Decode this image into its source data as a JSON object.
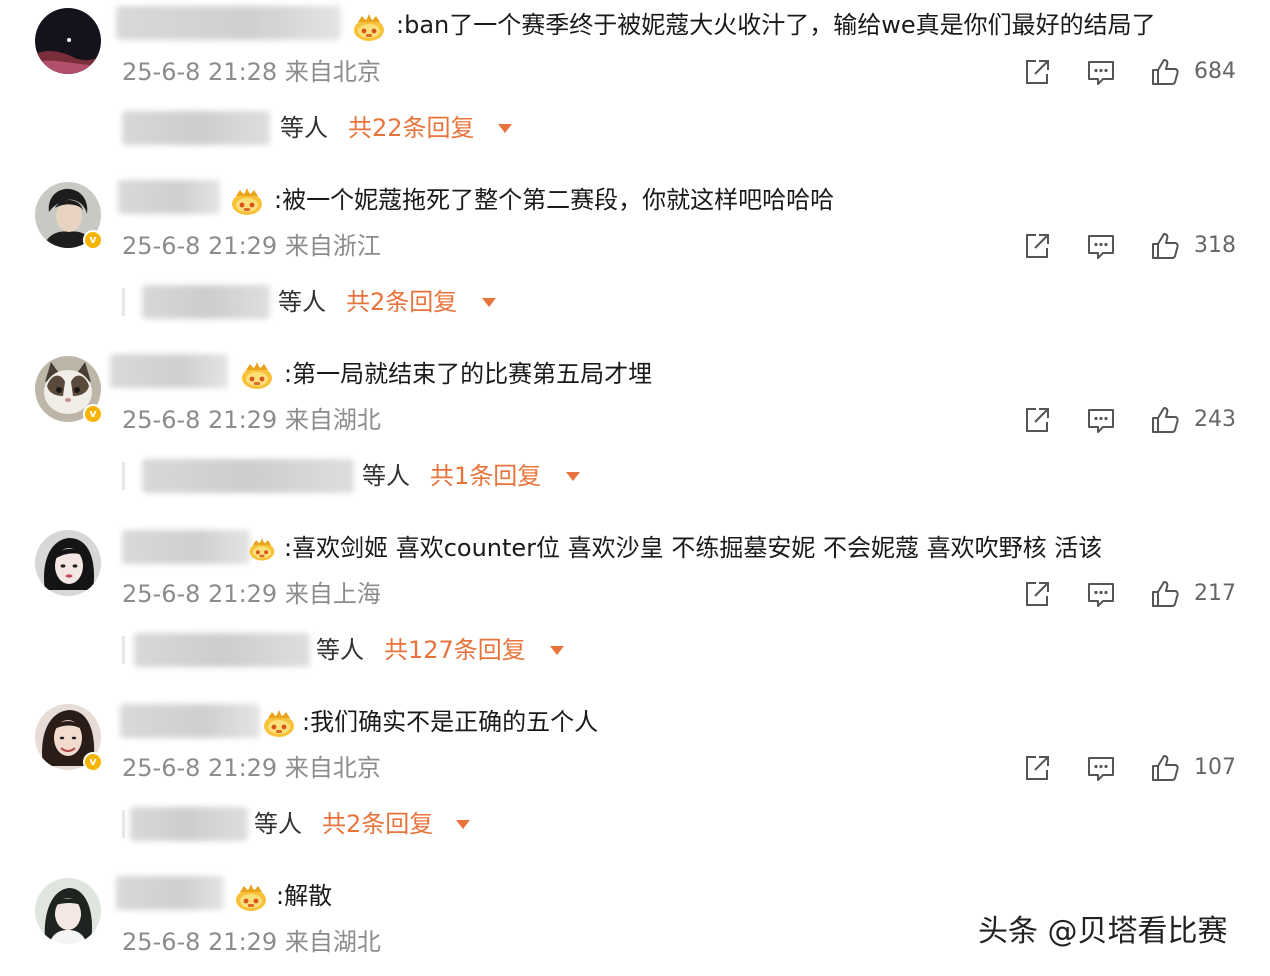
{
  "comments": [
    {
      "text": ":ban了一个赛季终于被妮蔻大火收汁了，输给we真是你们最好的结局了",
      "time": "25-6-8 21:28",
      "location": "来自北京",
      "likes": "684",
      "reply_suffix": "等人",
      "reply_count": "共22条回复",
      "verified": false
    },
    {
      "text": ":被一个妮蔻拖死了整个第二赛段，你就这样吧哈哈哈",
      "time": "25-6-8 21:29",
      "location": "来自浙江",
      "likes": "318",
      "reply_suffix": "等人",
      "reply_count": "共2条回复",
      "verified": true
    },
    {
      "text": ":第一局就结束了的比赛第五局才埋",
      "time": "25-6-8 21:29",
      "location": "来自湖北",
      "likes": "243",
      "reply_suffix": "等人",
      "reply_count": "共1条回复",
      "verified": true
    },
    {
      "text": ":喜欢剑姬 喜欢counter位 喜欢沙皇 不练掘墓安妮 不会妮蔻 喜欢吹野核 活该",
      "time": "25-6-8 21:29",
      "location": "来自上海",
      "likes": "217",
      "reply_suffix": "等人",
      "reply_count": "共127条回复",
      "verified": false
    },
    {
      "text": ":我们确实不是正确的五个人",
      "time": "25-6-8 21:29",
      "location": "来自北京",
      "likes": "107",
      "reply_suffix": "等人",
      "reply_count": "共2条回复",
      "verified": true
    },
    {
      "text": ":解散",
      "time": "25-6-8 21:29",
      "location": "来自湖北",
      "verified": false
    }
  ],
  "watermark": "头条 @贝塔看比赛",
  "colors": {
    "reply_accent": "#e8743b",
    "meta_gray": "#8c8c8c",
    "verified_badge": "#f6b400"
  },
  "icons": {
    "share": "share-icon",
    "comment": "comment-icon",
    "like": "thumbs-up-icon",
    "fan_badge": "crown-icon",
    "expand": "caret-down-icon"
  }
}
